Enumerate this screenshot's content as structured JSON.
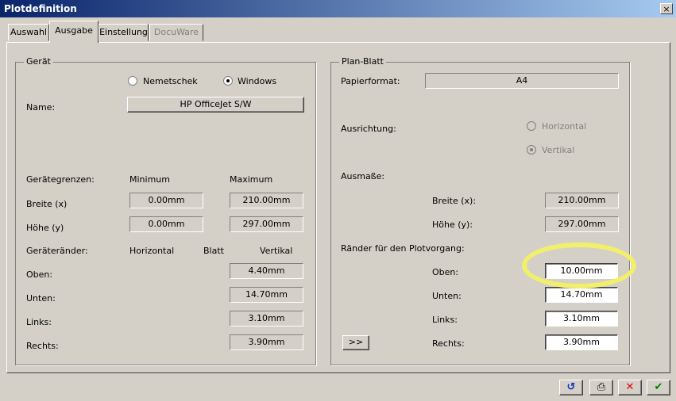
{
  "window": {
    "title": "Plotdefinition",
    "close_glyph": "×"
  },
  "tabs": [
    {
      "label": "Auswahl",
      "active": false,
      "disabled": false
    },
    {
      "label": "Ausgabe",
      "active": true,
      "disabled": false
    },
    {
      "label": "Einstellung",
      "active": false,
      "disabled": false
    },
    {
      "label": "DocuWare",
      "active": false,
      "disabled": true
    }
  ],
  "geraet": {
    "legend": "Gerät",
    "radio_nemetschek": "Nemetschek",
    "radio_windows": "Windows",
    "selected_driver": "Windows",
    "name_label": "Name:",
    "name_value": "HP OfficeJet S/W",
    "grenzen_label": "Gerätegrenzen:",
    "minimum_label": "Minimum",
    "maximum_label": "Maximum",
    "breite_label": "Breite (x)",
    "breite_min": "0.00mm",
    "breite_max": "210.00mm",
    "hoehe_label": "Höhe (y)",
    "hoehe_min": "0.00mm",
    "hoehe_max": "297.00mm",
    "raender_label": "Geräteränder:",
    "horizontal_label": "Horizontal",
    "blatt_label": "Blatt",
    "vertikal_label": "Vertikal",
    "oben_label": "Oben:",
    "oben_value": "4.40mm",
    "unten_label": "Unten:",
    "unten_value": "14.70mm",
    "links_label": "Links:",
    "links_value": "3.10mm",
    "rechts_label": "Rechts:",
    "rechts_value": "3.90mm"
  },
  "planblatt": {
    "legend": "Plan-Blatt",
    "papierformat_label": "Papierformat:",
    "papierformat_value": "A4",
    "ausrichtung_label": "Ausrichtung:",
    "radio_horizontal": "Horizontal",
    "radio_vertikal": "Vertikal",
    "selected_orientation": "Vertikal",
    "ausmasse_label": "Ausmaße:",
    "breite_label": "Breite (x):",
    "breite_value": "210.00mm",
    "hoehe_label": "Höhe (y):",
    "hoehe_value": "297.00mm",
    "raender_label": "Ränder für den Plotvorgang:",
    "oben_label": "Oben:",
    "oben_value": "10.00mm",
    "unten_label": "Unten:",
    "unten_value": "14.70mm",
    "links_label": "Links:",
    "links_value": "3.10mm",
    "rechts_label": "Rechts:",
    "rechts_value": "3.90mm",
    "copy_button": ">>"
  },
  "bottom_buttons": [
    {
      "name": "undo-button",
      "icon": "undo-icon",
      "glyph": "↺",
      "color": "#1030c0"
    },
    {
      "name": "print-button",
      "icon": "printer-icon",
      "glyph": "⎙",
      "color": "#000000"
    },
    {
      "name": "cancel-button",
      "icon": "red-x-icon",
      "glyph": "✕",
      "color": "#e00000"
    },
    {
      "name": "ok-button",
      "icon": "green-check-icon",
      "glyph": "✔",
      "color": "#008000"
    }
  ],
  "colors": {
    "highlight": "#f2f06a",
    "titlebar_start": "#0a246a",
    "titlebar_end": "#a6caf0"
  }
}
